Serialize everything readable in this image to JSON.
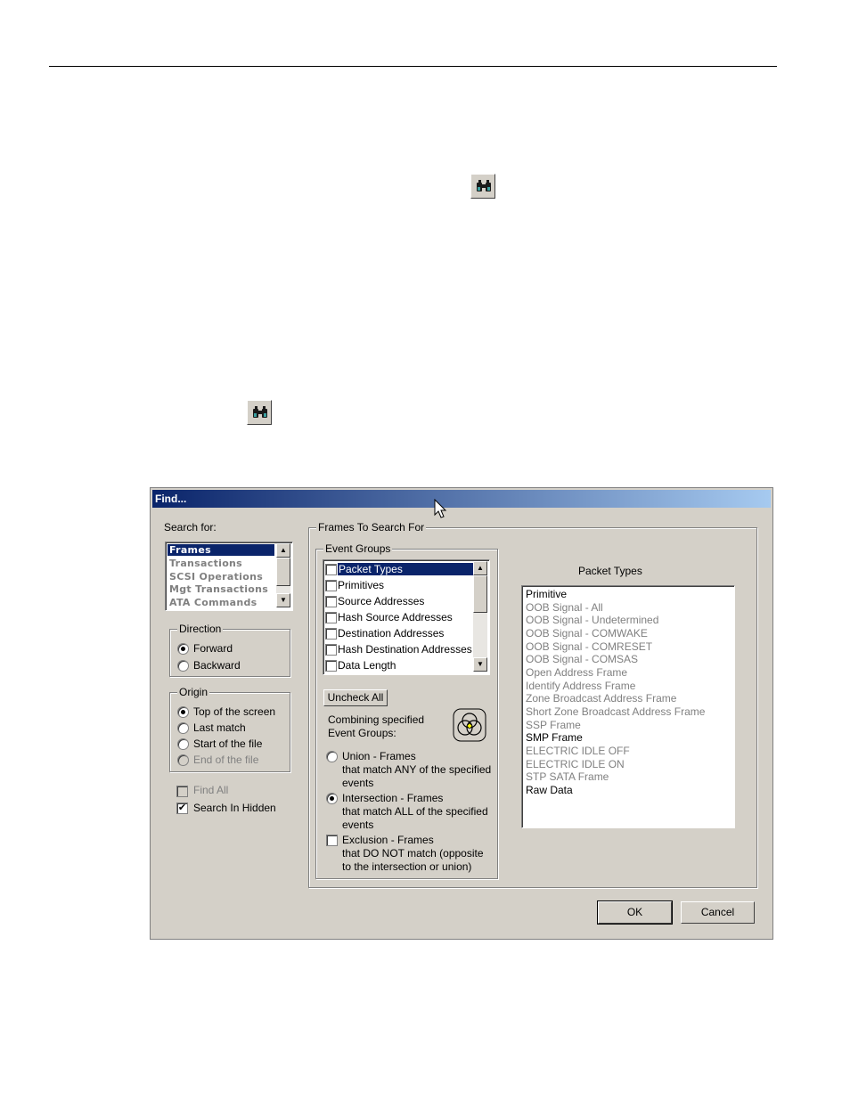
{
  "dialog": {
    "title": "Find...",
    "search_for": {
      "label": "Search for:",
      "items": [
        {
          "label": "Frames",
          "selected": true
        },
        {
          "label": "Transactions",
          "selected": false
        },
        {
          "label": "SCSI Operations",
          "selected": false
        },
        {
          "label": "Mgt Transactions",
          "selected": false
        },
        {
          "label": "ATA Commands",
          "selected": false
        }
      ]
    },
    "direction": {
      "legend": "Direction",
      "options": [
        {
          "label": "Forward",
          "checked": true
        },
        {
          "label": "Backward",
          "checked": false
        }
      ]
    },
    "origin": {
      "legend": "Origin",
      "options": [
        {
          "label": "Top of the screen",
          "checked": true,
          "disabled": false
        },
        {
          "label": "Last match",
          "checked": false,
          "disabled": false
        },
        {
          "label": "Start of the file",
          "checked": false,
          "disabled": false
        },
        {
          "label": "End of the file",
          "checked": false,
          "disabled": true
        }
      ]
    },
    "find_all": {
      "label": "Find All",
      "checked": false,
      "disabled": true
    },
    "search_in_hidden": {
      "label": "Search In Hidden",
      "checked": true
    },
    "frames_to_search": {
      "legend": "Frames To Search For",
      "event_groups": {
        "legend": "Event Groups",
        "items": [
          {
            "label": "Packet Types",
            "checked": false,
            "selected": true
          },
          {
            "label": "Primitives",
            "checked": false
          },
          {
            "label": "Source Addresses",
            "checked": false
          },
          {
            "label": "Hash Source Addresses",
            "checked": false
          },
          {
            "label": "Destination Addresses",
            "checked": false
          },
          {
            "label": "Hash Destination Addresses",
            "checked": false
          },
          {
            "label": "Data Length",
            "checked": false
          }
        ]
      },
      "uncheck_all": "Uncheck All",
      "combining_label_1": "Combining specified",
      "combining_label_2": "Event Groups:",
      "union": {
        "label_1": "Union - Frames",
        "label_2": "that match ANY of the specified",
        "label_3": "events",
        "checked": false
      },
      "intersection": {
        "label_1": "Intersection - Frames",
        "label_2": "that match ALL of the specified",
        "label_3": "events",
        "checked": true
      },
      "exclusion": {
        "label_1": "Exclusion - Frames",
        "label_2": "that DO NOT match (opposite",
        "label_3": "to the intersection or union)",
        "checked": false
      },
      "packet_types": {
        "title": "Packet Types",
        "items": [
          {
            "label": "Primitive",
            "enabled": true
          },
          {
            "label": "OOB Signal - All",
            "enabled": false
          },
          {
            "label": "OOB Signal - Undetermined",
            "enabled": false
          },
          {
            "label": "OOB Signal - COMWAKE",
            "enabled": false
          },
          {
            "label": "OOB Signal - COMRESET",
            "enabled": false
          },
          {
            "label": "OOB Signal - COMSAS",
            "enabled": false
          },
          {
            "label": "Open Address Frame",
            "enabled": false
          },
          {
            "label": "Identify Address Frame",
            "enabled": false
          },
          {
            "label": "Zone Broadcast Address Frame",
            "enabled": false
          },
          {
            "label": "Short Zone Broadcast Address Frame",
            "enabled": false
          },
          {
            "label": "SSP Frame",
            "enabled": false
          },
          {
            "label": "SMP Frame",
            "enabled": true
          },
          {
            "label": "ELECTRIC IDLE OFF",
            "enabled": false
          },
          {
            "label": "ELECTRIC IDLE ON",
            "enabled": false
          },
          {
            "label": "STP SATA Frame",
            "enabled": false
          },
          {
            "label": "Raw Data",
            "enabled": true
          }
        ]
      }
    },
    "ok": "OK",
    "cancel": "Cancel"
  },
  "icons": {
    "toolbar_find_1": "binoculars-icon",
    "toolbar_find_2": "binoculars-icon",
    "cursor": "mouse-pointer-icon",
    "venn": "venn-diagram-icon"
  }
}
